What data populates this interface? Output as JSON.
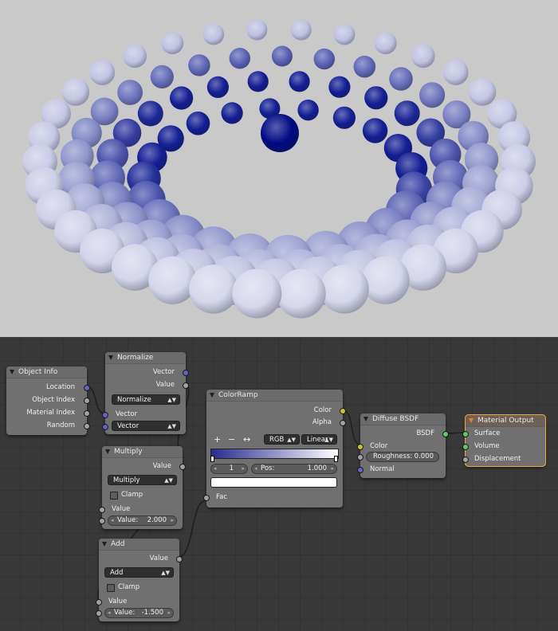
{
  "render_view": {
    "background": "#c9c9c9",
    "sphere_near_color": "#eeeef6",
    "sphere_far_color": "#000c8a",
    "center_sphere_color": "#000a83"
  },
  "node_editor": {
    "background": "#393939",
    "nodes": {
      "object_info": {
        "title": "Object Info",
        "outputs": [
          "Location",
          "Object Index",
          "Material Index",
          "Random"
        ]
      },
      "normalize": {
        "title": "Normalize",
        "outputs": [
          "Vector",
          "Value"
        ],
        "operation": "Normalize",
        "inputs": [
          "Vector"
        ],
        "input_mode": "Vector"
      },
      "multiply": {
        "title": "Multiply",
        "output": "Value",
        "operation": "Multiply",
        "clamp_label": "Clamp",
        "input_label": "Value",
        "value_label": "Value:",
        "value": "2.000"
      },
      "add": {
        "title": "Add",
        "output": "Value",
        "operation": "Add",
        "clamp_label": "Clamp",
        "input_label": "Value",
        "value_label": "Value:",
        "value": "-1.500"
      },
      "colorramp": {
        "title": "ColorRamp",
        "outputs": [
          "Color",
          "Alpha"
        ],
        "tool_add": "+",
        "tool_remove": "−",
        "tool_flip": "↔",
        "color_mode": "RGB",
        "interpolation": "Linear",
        "ramp_start": "#2a2a90",
        "ramp_end": "#ffffff",
        "stop_index": "1",
        "pos_label": "Pos:",
        "pos_value": "1.000",
        "stop_color": "#ffffff",
        "input": "Fac"
      },
      "diffuse": {
        "title": "Diffuse BSDF",
        "output": "BSDF",
        "color_label": "Color",
        "roughness_label": "Roughness:",
        "roughness_value": "0.000",
        "normal_label": "Normal"
      },
      "material_output": {
        "title": "Material Output",
        "inputs": [
          "Surface",
          "Volume",
          "Displacement"
        ]
      }
    }
  }
}
